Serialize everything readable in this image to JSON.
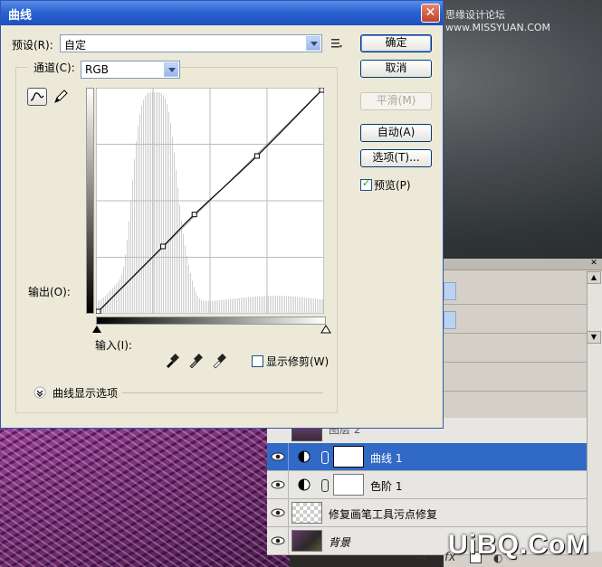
{
  "window": {
    "title": "曲线",
    "close_glyph": "✕"
  },
  "background": {
    "site_text": "思缘设计论坛 www.MISSYUAN.COM"
  },
  "preset": {
    "label": "预设(R):",
    "value": "自定"
  },
  "channel": {
    "label": "通道(C):",
    "value": "RGB"
  },
  "buttons": {
    "ok": "确定",
    "cancel": "取消",
    "smooth": "平滑(M)",
    "auto": "自动(A)",
    "options": "选项(T)..."
  },
  "preview": {
    "label": "预览(P)",
    "checked": true
  },
  "axes": {
    "output_label": "输出(O):",
    "input_label": "输入(I):"
  },
  "show_clipping": {
    "label": "显示修剪(W)",
    "checked": false
  },
  "curve_display_options": {
    "label": "曲线显示选项"
  },
  "chart_data": {
    "type": "line",
    "xlim": [
      0,
      255
    ],
    "ylim": [
      0,
      255
    ],
    "grid": true,
    "curve_points": [
      [
        0,
        0
      ],
      [
        75,
        76
      ],
      [
        110,
        112
      ],
      [
        180,
        178
      ],
      [
        255,
        255
      ]
    ],
    "histogram_peak_range": [
      45,
      85
    ]
  },
  "layers": {
    "partial_top": "图层 2",
    "items": [
      {
        "name": "曲线 1",
        "selected": true,
        "type": "adjustment"
      },
      {
        "name": "色阶 1",
        "selected": false,
        "type": "adjustment"
      },
      {
        "name": "修复画笔工具污点修复",
        "selected": false,
        "type": "pixel"
      },
      {
        "name": "背景",
        "selected": false,
        "type": "background"
      }
    ]
  },
  "watermark": "UiBQ.CoM",
  "colors": {
    "title_bar": "#2b63d2",
    "selected_layer": "#3169c6",
    "dialog_bg": "#ece9d8"
  }
}
